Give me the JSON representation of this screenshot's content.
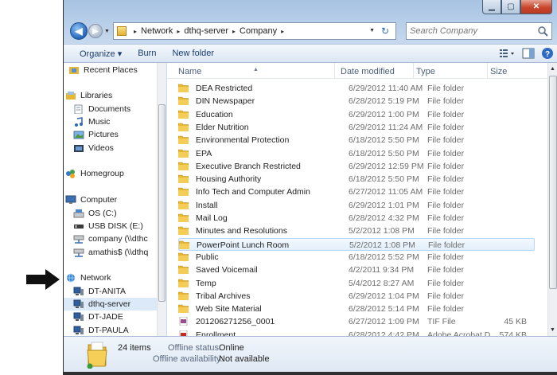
{
  "window": {
    "buttons": {
      "minimize": "▁",
      "maximize": "▢",
      "close": "✕"
    }
  },
  "nav": {
    "back_glyph": "◀",
    "forward_glyph": "▶",
    "recent_glyph": "▼"
  },
  "address": {
    "crumbs": [
      "Network",
      "dthq-server",
      "Company"
    ],
    "separator": "▸",
    "dropdown_glyph": "▼",
    "refresh_glyph": "↻"
  },
  "search": {
    "placeholder": "Search Company"
  },
  "toolbar": {
    "organize": "Organize ▾",
    "burn": "Burn",
    "new_folder": "New folder"
  },
  "sidebar": {
    "items": [
      {
        "label": "Recent Places",
        "icon": "recent-places-icon"
      },
      {
        "label": "Libraries",
        "icon": "libraries-icon"
      },
      {
        "label": "Documents",
        "icon": "documents-icon"
      },
      {
        "label": "Music",
        "icon": "music-icon"
      },
      {
        "label": "Pictures",
        "icon": "pictures-icon"
      },
      {
        "label": "Videos",
        "icon": "videos-icon"
      },
      {
        "label": "Homegroup",
        "icon": "homegroup-icon"
      },
      {
        "label": "Computer",
        "icon": "computer-icon"
      },
      {
        "label": "OS (C:)",
        "icon": "drive-icon"
      },
      {
        "label": "USB DISK (E:)",
        "icon": "usb-drive-icon"
      },
      {
        "label": "company (\\\\dthc",
        "icon": "network-drive-icon"
      },
      {
        "label": "amathis$ (\\\\dthq",
        "icon": "network-drive-icon"
      },
      {
        "label": "Network",
        "icon": "network-icon"
      },
      {
        "label": "DT-ANITA",
        "icon": "network-computer-icon"
      },
      {
        "label": "dthq-server",
        "icon": "network-computer-icon"
      },
      {
        "label": "DT-JADE",
        "icon": "network-computer-icon"
      },
      {
        "label": "DT-PAULA",
        "icon": "network-computer-icon"
      }
    ]
  },
  "columns": {
    "name": "Name",
    "date": "Date modified",
    "type": "Type",
    "size": "Size"
  },
  "files": [
    {
      "name": "DEA Restricted",
      "date": "6/29/2012 11:40 AM",
      "type": "File folder",
      "size": ""
    },
    {
      "name": "DIN Newspaper",
      "date": "6/28/2012 5:19 PM",
      "type": "File folder",
      "size": ""
    },
    {
      "name": "Education",
      "date": "6/29/2012 1:00 PM",
      "type": "File folder",
      "size": ""
    },
    {
      "name": "Elder Nutrition",
      "date": "6/29/2012 11:24 AM",
      "type": "File folder",
      "size": ""
    },
    {
      "name": "Environmental Protection",
      "date": "6/18/2012 5:50 PM",
      "type": "File folder",
      "size": ""
    },
    {
      "name": "EPA",
      "date": "6/18/2012 5:50 PM",
      "type": "File folder",
      "size": ""
    },
    {
      "name": "Executive Branch Restricted",
      "date": "6/29/2012 12:59 PM",
      "type": "File folder",
      "size": ""
    },
    {
      "name": "Housing Authority",
      "date": "6/18/2012 5:50 PM",
      "type": "File folder",
      "size": ""
    },
    {
      "name": "Info Tech and Computer Admin",
      "date": "6/27/2012 11:05 AM",
      "type": "File folder",
      "size": ""
    },
    {
      "name": "Install",
      "date": "6/29/2012 1:01 PM",
      "type": "File folder",
      "size": ""
    },
    {
      "name": "Mail Log",
      "date": "6/28/2012 4:32 PM",
      "type": "File folder",
      "size": ""
    },
    {
      "name": "Minutes and Resolutions",
      "date": "5/2/2012 1:08 PM",
      "type": "File folder",
      "size": ""
    },
    {
      "name": "PowerPoint Lunch Room",
      "date": "5/2/2012 1:08 PM",
      "type": "File folder",
      "size": ""
    },
    {
      "name": "Public",
      "date": "6/18/2012 5:52 PM",
      "type": "File folder",
      "size": ""
    },
    {
      "name": "Saved Voicemail",
      "date": "4/2/2011 9:34 PM",
      "type": "File folder",
      "size": ""
    },
    {
      "name": "Temp",
      "date": "5/4/2012 8:27 AM",
      "type": "File folder",
      "size": ""
    },
    {
      "name": "Tribal Archives",
      "date": "6/29/2012 1:04 PM",
      "type": "File folder",
      "size": ""
    },
    {
      "name": "Web Site Material",
      "date": "6/28/2012 5:14 PM",
      "type": "File folder",
      "size": ""
    },
    {
      "name": "201206271256_0001",
      "date": "6/27/2012 1:09 PM",
      "type": "TIF File",
      "size": "45 KB"
    },
    {
      "name": "Enrollment",
      "date": "6/28/2012 4:42 PM",
      "type": "Adobe Acrobat D...",
      "size": "574 KB"
    }
  ],
  "selected_file_index": 12,
  "details": {
    "count": "24 items",
    "offline_status_label": "Offline status:",
    "offline_status_value": "Online",
    "offline_availability_label": "Offline availability:",
    "offline_availability_value": "Not available"
  },
  "colors": {
    "folder": "#e8b731",
    "selection_bg": "#e3f0fc",
    "toolbar_text": "#1b3c6b",
    "close_button": "#c9462c"
  }
}
